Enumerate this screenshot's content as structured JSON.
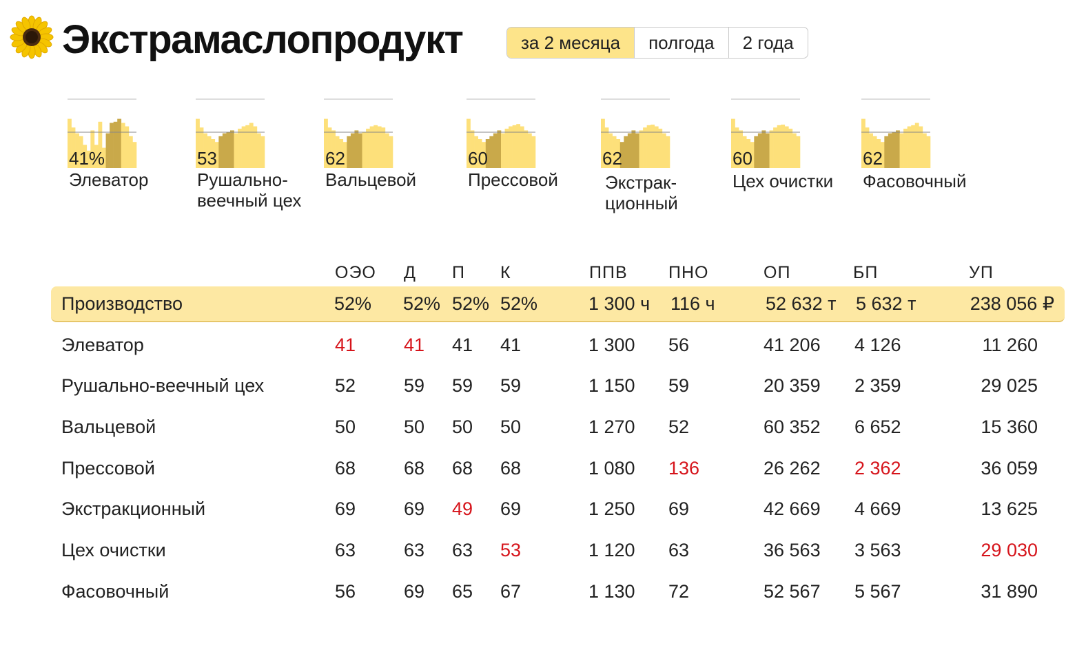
{
  "app": {
    "title": "Экстрамаслопродукт",
    "logo_icon": "sunflower-icon"
  },
  "periods": [
    {
      "label": "за 2 месяца",
      "active": true
    },
    {
      "label": "полгода",
      "active": false
    },
    {
      "label": "2 года",
      "active": false
    }
  ],
  "workshops_overview": [
    {
      "value": "41%",
      "label": [
        "Элеватор"
      ]
    },
    {
      "value": "53",
      "label": [
        "Рушально-",
        "веечный цех"
      ]
    },
    {
      "value": "62",
      "label": [
        "Вальцевой"
      ]
    },
    {
      "value": "60",
      "label": [
        "Прессовой"
      ]
    },
    {
      "value": "62",
      "label": [
        "Экстрак-",
        "ционный"
      ]
    },
    {
      "value": "60",
      "label": [
        "Цех очистки"
      ]
    },
    {
      "value": "62",
      "label": [
        "Фасовочный"
      ]
    }
  ],
  "table": {
    "columns": [
      "ОЭО",
      "Д",
      "П",
      "К",
      "ППВ",
      "ПНО",
      "ОП",
      "БП",
      "УП"
    ],
    "total": {
      "name": "Производство",
      "values": [
        "52%",
        "52%",
        "52%",
        "52%",
        "1 300 ч",
        "116 ч",
        "52 632 т",
        "5 632 т",
        "238 056 ₽"
      ]
    },
    "rows": [
      {
        "name": "Элеватор",
        "values": [
          "41",
          "41",
          "41",
          "41",
          "1 300",
          "56",
          "41 206",
          "4 126",
          "11 260"
        ],
        "alerts": [
          0,
          1
        ]
      },
      {
        "name": "Рушально-веечный цех",
        "values": [
          "52",
          "59",
          "59",
          "59",
          "1 150",
          "59",
          "20 359",
          "2 359",
          "29 025"
        ],
        "alerts": []
      },
      {
        "name": "Вальцевой",
        "values": [
          "50",
          "50",
          "50",
          "50",
          "1 270",
          "52",
          "60 352",
          "6 652",
          "15 360"
        ],
        "alerts": []
      },
      {
        "name": "Прессовой",
        "values": [
          "68",
          "68",
          "68",
          "68",
          "1 080",
          "136",
          "26 262",
          "2 362",
          "36 059"
        ],
        "alerts": [
          5,
          7
        ]
      },
      {
        "name": "Экстракционный",
        "values": [
          "69",
          "69",
          "49",
          "69",
          "1 250",
          "69",
          "42 669",
          "4 669",
          "13 625"
        ],
        "alerts": [
          2
        ]
      },
      {
        "name": "Цех очистки",
        "values": [
          "63",
          "63",
          "63",
          "53",
          "1 120",
          "63",
          "36 563",
          "3 563",
          "29 030"
        ],
        "alerts": [
          3,
          8
        ]
      },
      {
        "name": "Фасовочный",
        "values": [
          "56",
          "69",
          "65",
          "67",
          "1 130",
          "72",
          "52 567",
          "5 567",
          "31 890"
        ],
        "alerts": []
      }
    ]
  },
  "colors": {
    "accent": "#fde48a",
    "spark_fill": "#fde07a",
    "spark_highlight": "#c9a94a",
    "alert": "#d6141b"
  }
}
